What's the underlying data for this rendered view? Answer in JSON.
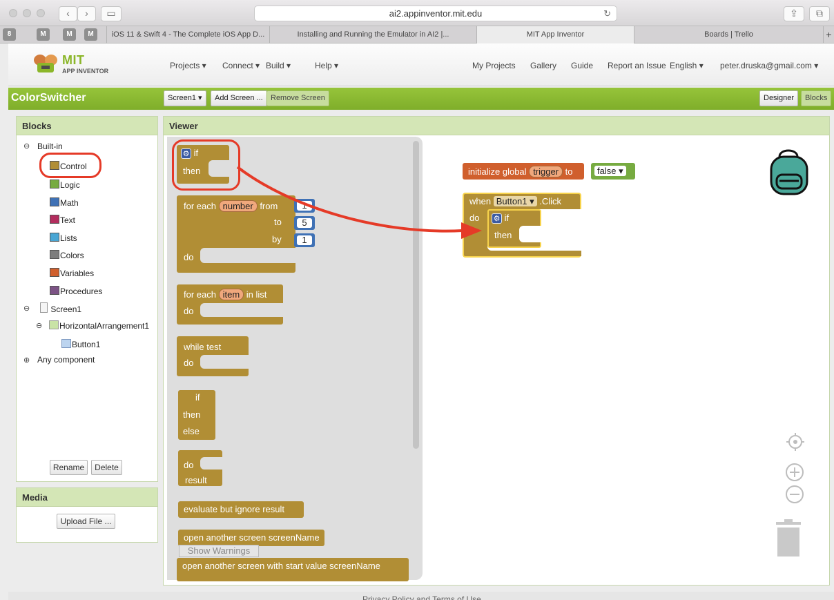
{
  "browser": {
    "url": "ai2.appinventor.mit.edu",
    "tabs": [
      {
        "label": "iOS 11 & Swift 4 - The Complete iOS App D..."
      },
      {
        "label": "Installing and Running the Emulator in AI2 |..."
      },
      {
        "label": "MIT App Inventor"
      },
      {
        "label": "Boards | Trello"
      }
    ],
    "pinned": [
      "8",
      "M",
      "M",
      "M"
    ],
    "new_tab": "+"
  },
  "header": {
    "logo_title": "MIT",
    "logo_subtitle": "APP INVENTOR",
    "menus": [
      "Projects ▾",
      "Connect ▾",
      "Build ▾",
      "Help ▾"
    ],
    "right_links": [
      "My Projects",
      "Gallery",
      "Guide",
      "Report an Issue",
      "English ▾",
      "peter.druska@gmail.com ▾"
    ]
  },
  "project": {
    "name": "ColorSwitcher",
    "screen_select": "Screen1 ▾",
    "add_screen": "Add Screen ...",
    "remove_screen": "Remove Screen",
    "designer": "Designer",
    "blocks": "Blocks"
  },
  "blocks_panel": {
    "title": "Blocks",
    "builtin": "Built-in",
    "categories": [
      {
        "label": "Control",
        "color": "#b18e35"
      },
      {
        "label": "Logic",
        "color": "#77ab41"
      },
      {
        "label": "Math",
        "color": "#3f71b5"
      },
      {
        "label": "Text",
        "color": "#b32d5e"
      },
      {
        "label": "Lists",
        "color": "#49a6d4"
      },
      {
        "label": "Colors",
        "color": "#7d7d7d"
      },
      {
        "label": "Variables",
        "color": "#d05f2d"
      },
      {
        "label": "Procedures",
        "color": "#7c5385"
      }
    ],
    "screen": "Screen1",
    "arrangement": "HorizontalArrangement1",
    "button": "Button1",
    "any_component": "Any component",
    "rename": "Rename",
    "delete": "Delete"
  },
  "media_panel": {
    "title": "Media",
    "upload": "Upload File ..."
  },
  "viewer": {
    "title": "Viewer",
    "flyout": {
      "if_block": {
        "if": "if",
        "then": "then"
      },
      "for_range": {
        "for_each": "for each",
        "var": "number",
        "from": "from",
        "to": "to",
        "by": "by",
        "do": "do",
        "from_val": "1",
        "to_val": "5",
        "by_val": "1"
      },
      "for_list": {
        "for_each": "for each",
        "var": "item",
        "in_list": "in list",
        "do": "do"
      },
      "while": {
        "while": "while",
        "test": "test",
        "do": "do"
      },
      "if_else": {
        "if": "if",
        "then": "then",
        "else": "else"
      },
      "do_result": {
        "do": "do",
        "result": "result"
      },
      "evaluate": "evaluate but ignore result",
      "open_screen": "open another screen  screenName",
      "open_screen_value": "open another screen with start value  screenName",
      "show_warnings": "Show Warnings"
    },
    "workspace": {
      "init_global": "initialize global",
      "var_name": "trigger",
      "to": "to",
      "false_val": "false ▾",
      "when": "when",
      "component": "Button1 ▾",
      "event": ".Click",
      "do": "do",
      "if": "if",
      "then": "then"
    }
  },
  "footer": "Privacy Policy and Terms of Use",
  "colors": {
    "control": "#b18e35",
    "green_bar": "#8bc34a",
    "highlight": "#e53a27",
    "variable": "#d05f2d",
    "logic": "#77ab41"
  }
}
